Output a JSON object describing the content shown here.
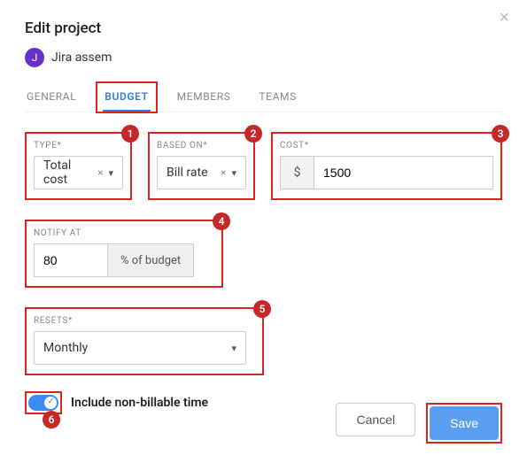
{
  "dialog": {
    "title": "Edit project",
    "project_initial": "J",
    "project_name": "Jira assem"
  },
  "tabs": {
    "general": "GENERAL",
    "budget": "BUDGET",
    "members": "MEMBERS",
    "teams": "TEAMS"
  },
  "fields": {
    "type": {
      "label": "TYPE*",
      "value": "Total cost"
    },
    "based_on": {
      "label": "BASED ON*",
      "value": "Bill rate"
    },
    "cost": {
      "label": "COST*",
      "currency": "$",
      "value": "1500"
    },
    "notify": {
      "label": "NOTIFY AT",
      "value": "80",
      "suffix": "% of budget"
    },
    "resets": {
      "label": "RESETS*",
      "value": "Monthly"
    },
    "include_nonbillable": {
      "label": "Include non-billable time",
      "on": true
    }
  },
  "actions": {
    "cancel": "Cancel",
    "save": "Save"
  },
  "markers": {
    "m1": "1",
    "m2": "2",
    "m3": "3",
    "m4": "4",
    "m5": "5",
    "m6": "6"
  }
}
